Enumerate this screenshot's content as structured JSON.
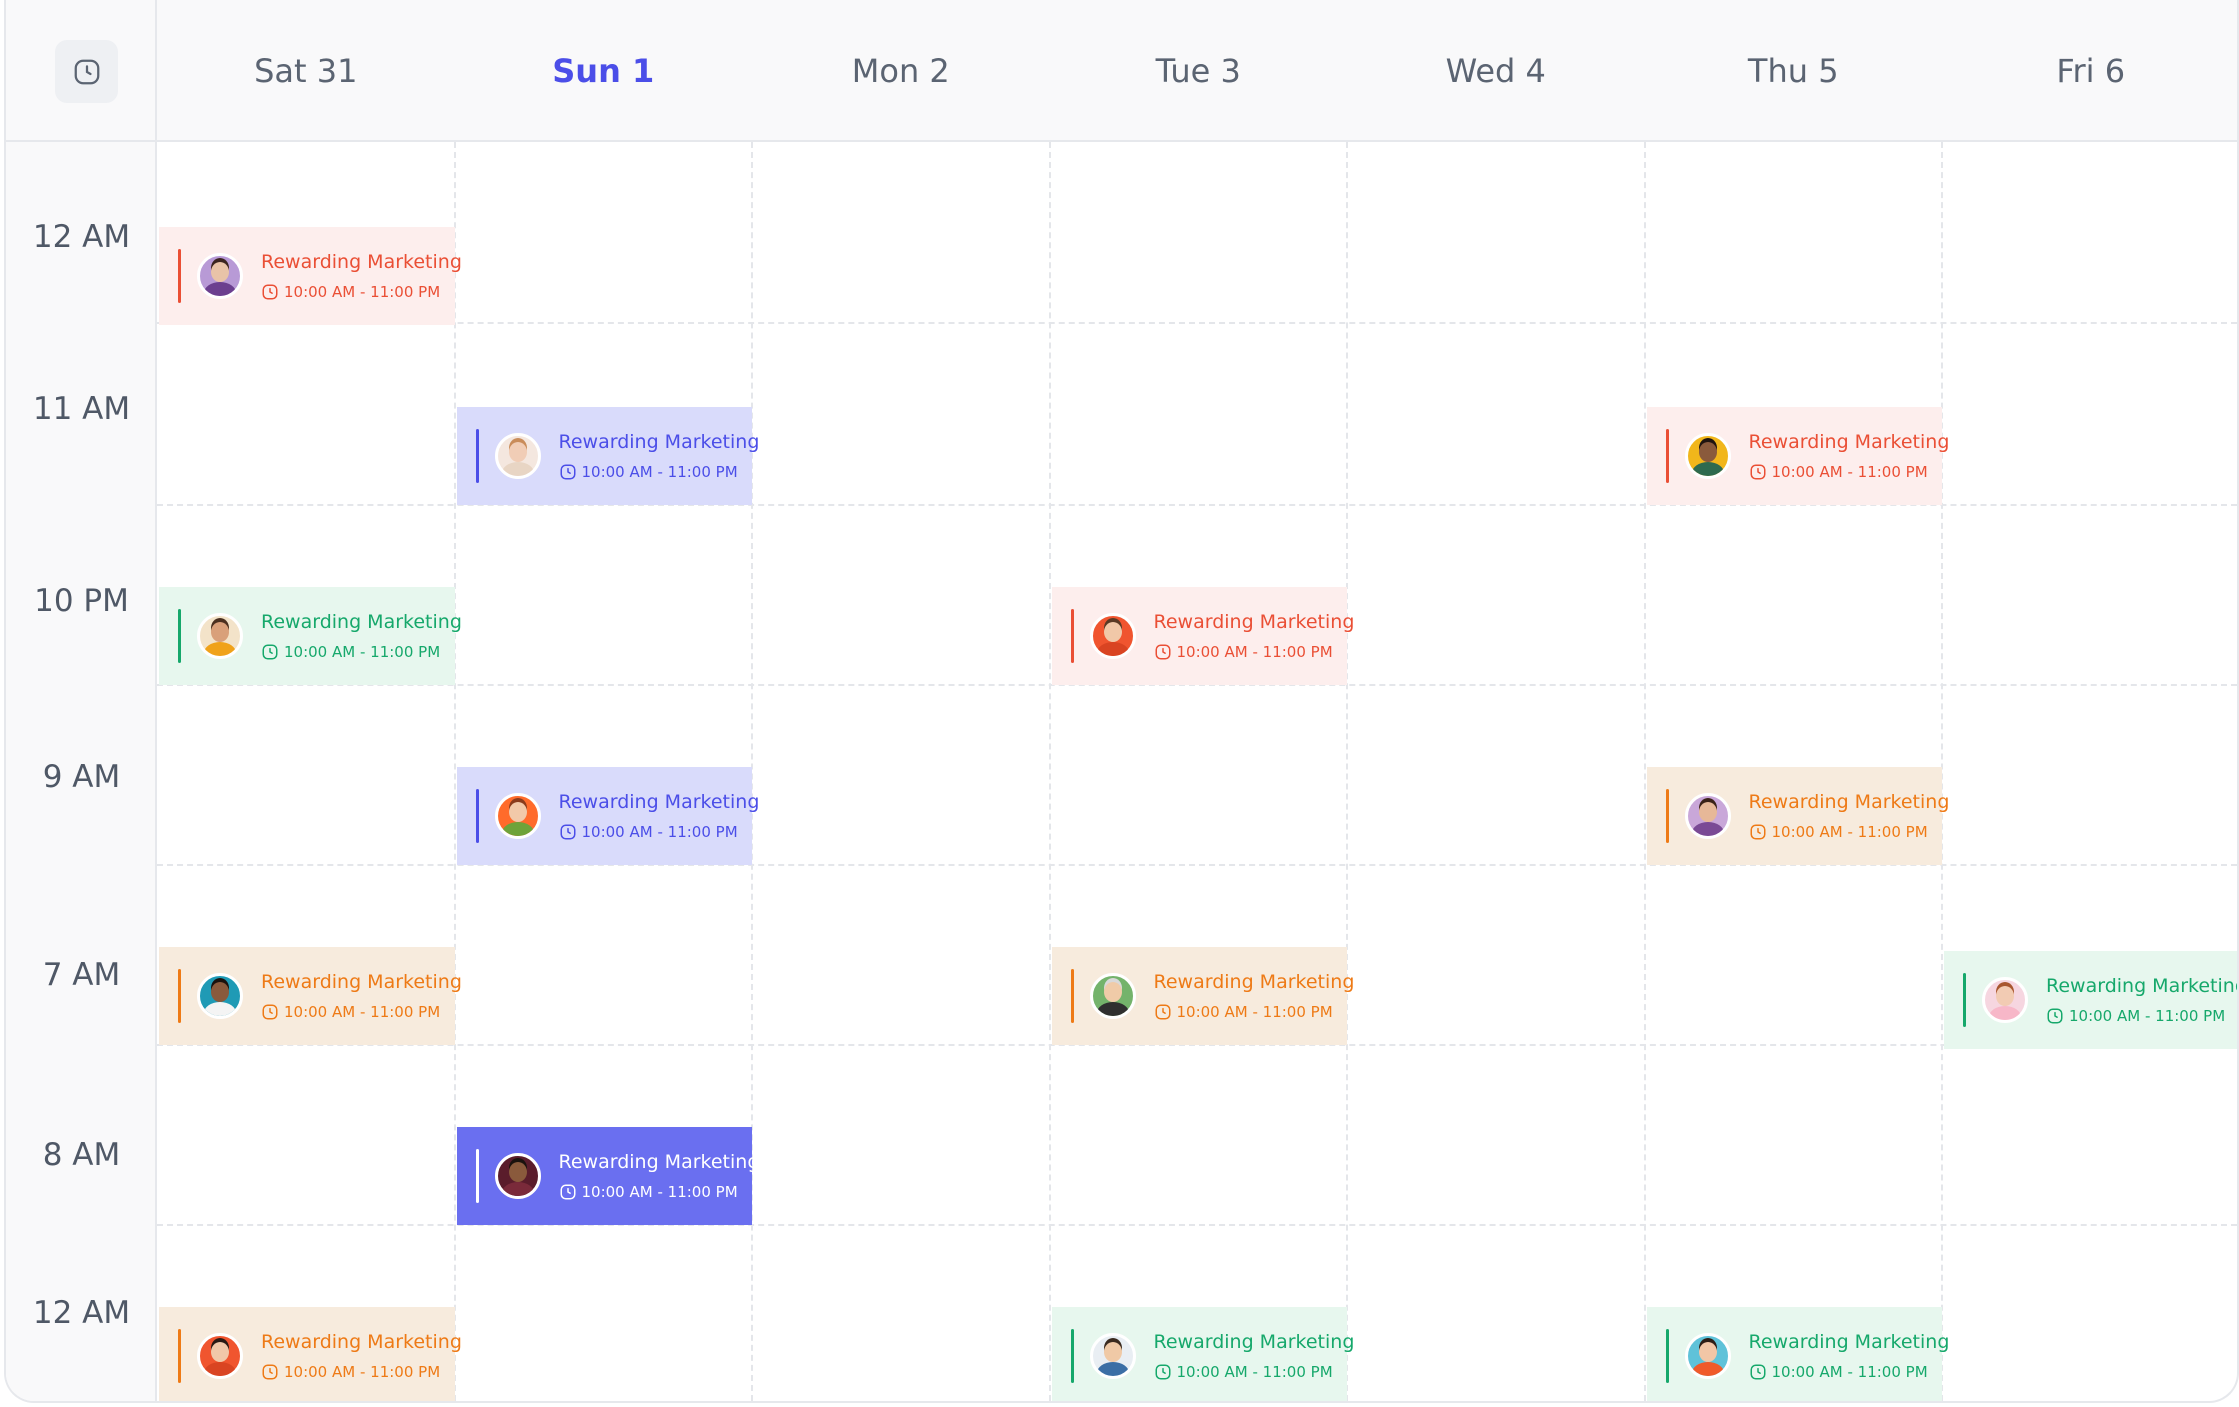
{
  "days": [
    {
      "label": "Sat 31",
      "today": false
    },
    {
      "label": "Sun 1",
      "today": true
    },
    {
      "label": "Mon 2",
      "today": false
    },
    {
      "label": "Tue 3",
      "today": false
    },
    {
      "label": "Wed 4",
      "today": false
    },
    {
      "label": "Thu 5",
      "today": false
    },
    {
      "label": "Fri 6",
      "today": false
    }
  ],
  "time_labels": [
    "12 AM",
    "11 AM",
    "10 PM",
    "9 AM",
    "7 AM",
    "8 AM",
    "12 AM"
  ],
  "theme": {
    "today_color": "#4b4ee8",
    "styles": {
      "red": {
        "bg": "#fdeeed",
        "fg": "#ea4f35"
      },
      "green": {
        "bg": "#e7f7ee",
        "fg": "#16a86b"
      },
      "indigo": {
        "bg": "#d9dbfb",
        "fg": "#4b4ee8"
      },
      "orange": {
        "bg": "#f7ebdd",
        "fg": "#ee7a16"
      },
      "solid": {
        "bg": "#6a6ff0",
        "fg": "#ffffff"
      }
    }
  },
  "events": [
    {
      "day": 0,
      "slot": 0,
      "style": "red",
      "title": "Rewarding Marketing",
      "time": "10:00 AM - 11:00 PM",
      "avatar": {
        "bg": "#b89ad6",
        "skin": "#e9c3a8",
        "hair": "#3b2420",
        "shirt": "#6b3f8f"
      }
    },
    {
      "day": 1,
      "slot": 1,
      "style": "indigo",
      "title": "Rewarding Marketing",
      "time": "10:00 AM - 11:00 PM",
      "avatar": {
        "bg": "#f4e7df",
        "skin": "#f1cdb6",
        "hair": "#c98c5a",
        "shirt": "#e8d5c4"
      }
    },
    {
      "day": 5,
      "slot": 1,
      "style": "red",
      "title": "Rewarding Marketing",
      "time": "10:00 AM - 11:00 PM",
      "avatar": {
        "bg": "#f1b61b",
        "skin": "#8a5a3c",
        "hair": "#1f1410",
        "shirt": "#2d6a4f"
      }
    },
    {
      "day": 0,
      "slot": 2,
      "style": "green",
      "title": "Rewarding Marketing",
      "time": "10:00 AM - 11:00 PM",
      "avatar": {
        "bg": "#f3e3c9",
        "skin": "#d9a07a",
        "hair": "#4a2f1f",
        "shirt": "#f0a21a"
      }
    },
    {
      "day": 3,
      "slot": 2,
      "style": "red",
      "title": "Rewarding Marketing",
      "time": "10:00 AM - 11:00 PM",
      "avatar": {
        "bg": "#f0552f",
        "skin": "#f1c8a8",
        "hair": "#5a3a25",
        "shirt": "#d94422"
      }
    },
    {
      "day": 1,
      "slot": 3,
      "style": "indigo",
      "title": "Rewarding Marketing",
      "time": "10:00 AM - 11:00 PM",
      "avatar": {
        "bg": "#ff6b2b",
        "skin": "#f2c9a9",
        "hair": "#8a3b1c",
        "shirt": "#6ea33a"
      }
    },
    {
      "day": 5,
      "slot": 3,
      "style": "orange",
      "title": "Rewarding Marketing",
      "time": "10:00 AM - 11:00 PM",
      "avatar": {
        "bg": "#c9a7d9",
        "skin": "#e7b898",
        "hair": "#3a2218",
        "shirt": "#7a4a95"
      }
    },
    {
      "day": 0,
      "slot": 4,
      "style": "orange",
      "title": "Rewarding Marketing",
      "time": "10:00 AM - 11:00 PM",
      "avatar": {
        "bg": "#1f9ab5",
        "skin": "#8a5a3c",
        "hair": "#1a120e",
        "shirt": "#f4f4f4"
      }
    },
    {
      "day": 3,
      "slot": 4,
      "style": "orange",
      "title": "Rewarding Marketing",
      "time": "10:00 AM - 11:00 PM",
      "avatar": {
        "bg": "#74b36b",
        "skin": "#f0cba8",
        "hair": "#d9d9d9",
        "shirt": "#2f2f2f"
      }
    },
    {
      "day": 6,
      "slot": 4,
      "style": "green",
      "title": "Rewarding Marketing",
      "time": "10:00 AM - 11:00 PM",
      "avatar": {
        "bg": "#f6d6e0",
        "skin": "#f2cbb3",
        "hair": "#a8562e",
        "shirt": "#f7b7c8"
      }
    },
    {
      "day": 1,
      "slot": 5,
      "style": "solid",
      "title": "Rewarding Marketing",
      "time": "10:00 AM - 11:00 PM",
      "avatar": {
        "bg": "#5a1c2b",
        "skin": "#8a5a3c",
        "hair": "#1a120e",
        "shirt": "#7a2a3a"
      }
    },
    {
      "day": 0,
      "slot": 6,
      "style": "orange",
      "title": "Rewarding Marketing",
      "time": "10:00 AM - 11:00 PM",
      "avatar": {
        "bg": "#f0552f",
        "skin": "#f1c8a8",
        "hair": "#2a1a14",
        "shirt": "#d94422"
      }
    },
    {
      "day": 3,
      "slot": 6,
      "style": "green",
      "title": "Rewarding Marketing",
      "time": "10:00 AM - 11:00 PM",
      "avatar": {
        "bg": "#e9eef3",
        "skin": "#f0c9a6",
        "hair": "#3a2a1f",
        "shirt": "#3b6ea5"
      }
    },
    {
      "day": 5,
      "slot": 6,
      "style": "green",
      "title": "Rewarding Marketing",
      "time": "10:00 AM - 11:00 PM",
      "avatar": {
        "bg": "#5fc2d9",
        "skin": "#f2c6a6",
        "hair": "#2d1d15",
        "shirt": "#f05a2a"
      }
    }
  ]
}
